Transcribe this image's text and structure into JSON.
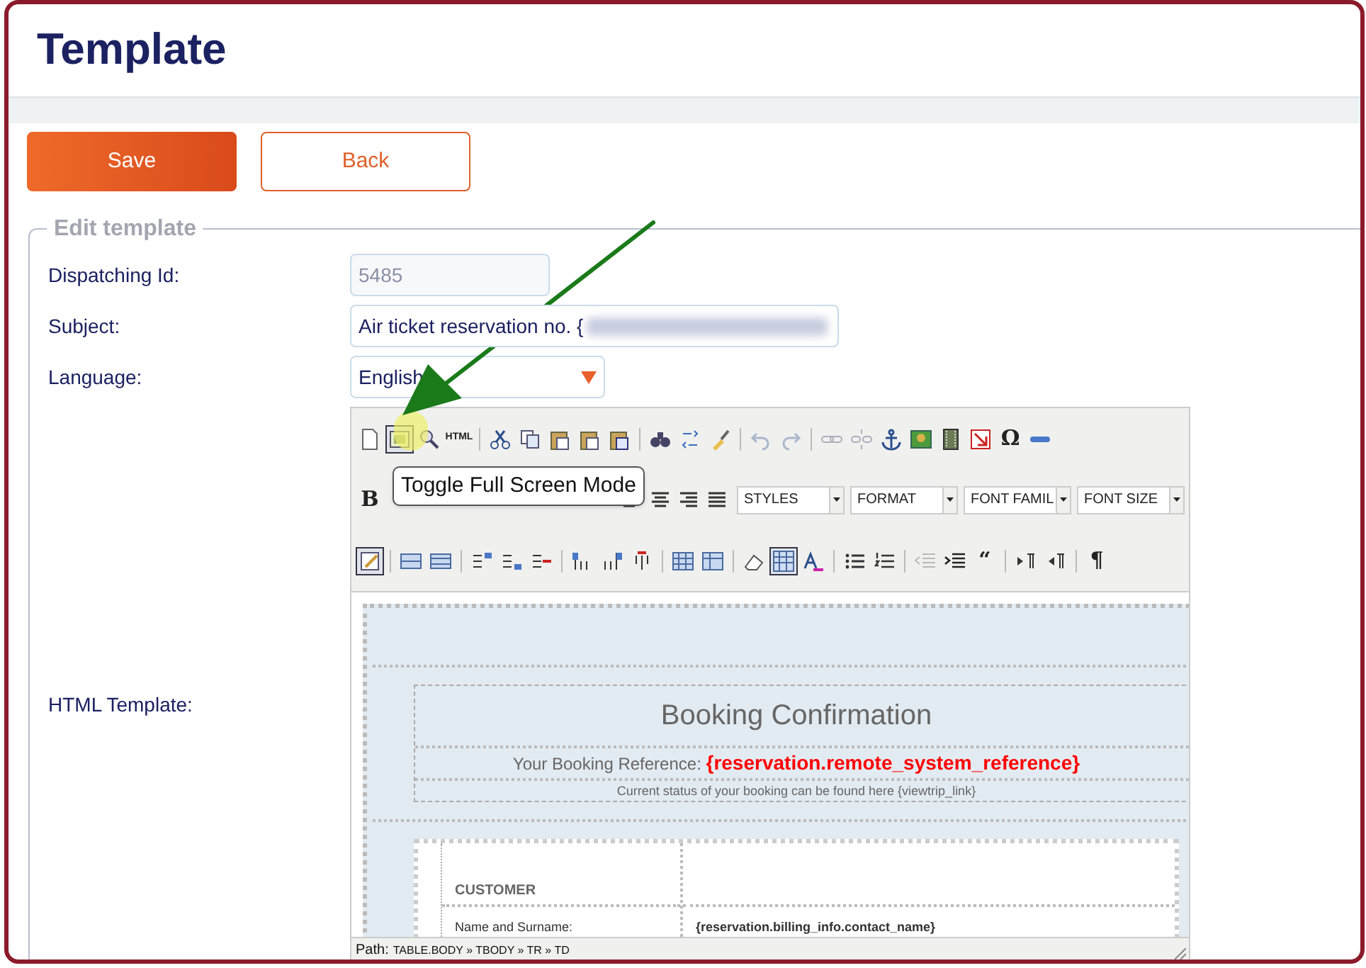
{
  "page": {
    "title": "Template"
  },
  "actions": [
    {
      "label": "Save",
      "kind": "primary"
    },
    {
      "label": "Back",
      "kind": "secondary"
    }
  ],
  "form": {
    "legend": "Edit template",
    "fields": [
      {
        "label": "Dispatching Id:",
        "kind": "input",
        "value": "5485",
        "disabled": true
      },
      {
        "label": "Subject:",
        "kind": "input",
        "value": "Air ticket reservation no. {",
        "disabled": false,
        "redacted": true
      },
      {
        "label": "Language:",
        "kind": "select",
        "value": "English",
        "disabled": false
      },
      {
        "label": "HTML Template:",
        "kind": "editor"
      }
    ]
  },
  "editor": {
    "toolbar_rows": [
      [
        {
          "kind": "icon"
        },
        {
          "kind": "icon",
          "selected": true
        },
        {
          "kind": "icon"
        },
        {
          "kind": "text",
          "label": "HTML"
        },
        {
          "kind": "sep"
        },
        {
          "kind": "icon"
        },
        {
          "kind": "icon"
        },
        {
          "kind": "icon"
        },
        {
          "kind": "icon"
        },
        {
          "kind": "icon"
        },
        {
          "kind": "sep"
        },
        {
          "kind": "icon"
        },
        {
          "kind": "icon"
        },
        {
          "kind": "icon"
        },
        {
          "kind": "sep"
        },
        {
          "kind": "icon",
          "disabled": true
        },
        {
          "kind": "icon",
          "disabled": true
        },
        {
          "kind": "sep"
        },
        {
          "kind": "icon",
          "disabled": true
        },
        {
          "kind": "icon",
          "disabled": true
        },
        {
          "kind": "icon"
        },
        {
          "kind": "icon"
        },
        {
          "kind": "icon"
        },
        {
          "kind": "icon"
        },
        {
          "kind": "text",
          "label": "Ω"
        },
        {
          "kind": "icon"
        }
      ],
      [
        {
          "kind": "text",
          "label": "B"
        },
        {
          "kind": "gap"
        },
        {
          "kind": "icon"
        },
        {
          "kind": "icon"
        },
        {
          "kind": "icon"
        },
        {
          "kind": "icon"
        },
        {
          "kind": "select",
          "label": "STYLES"
        },
        {
          "kind": "select",
          "label": "FORMAT"
        },
        {
          "kind": "select",
          "label": "FONT FAMIL"
        },
        {
          "kind": "select",
          "label": "FONT SIZE"
        }
      ],
      [
        {
          "kind": "icon",
          "selected": true
        },
        {
          "kind": "sep"
        },
        {
          "kind": "icon"
        },
        {
          "kind": "icon"
        },
        {
          "kind": "sep"
        },
        {
          "kind": "icon"
        },
        {
          "kind": "icon"
        },
        {
          "kind": "icon"
        },
        {
          "kind": "sep"
        },
        {
          "kind": "icon"
        },
        {
          "kind": "icon"
        },
        {
          "kind": "icon"
        },
        {
          "kind": "sep"
        },
        {
          "kind": "icon"
        },
        {
          "kind": "icon"
        },
        {
          "kind": "sep"
        },
        {
          "kind": "icon"
        },
        {
          "kind": "icon",
          "selected": true
        },
        {
          "kind": "icon"
        },
        {
          "kind": "sep"
        },
        {
          "kind": "icon"
        },
        {
          "kind": "icon"
        },
        {
          "kind": "sep"
        },
        {
          "kind": "icon",
          "disabled": true
        },
        {
          "kind": "icon"
        },
        {
          "kind": "text",
          "label": "“"
        },
        {
          "kind": "sep"
        },
        {
          "kind": "icon"
        },
        {
          "kind": "icon"
        },
        {
          "kind": "sep"
        },
        {
          "kind": "text",
          "label": "¶"
        }
      ]
    ],
    "tooltip": "Toggle Full Screen Mode",
    "content": {
      "heading": "Booking Confirmation",
      "reference_label": "Your Booking Reference:",
      "reference_value": "{reservation.remote_system_reference}",
      "status_note": "Current status of your booking can be found here {viewtrip_link}",
      "section": "CUSTOMER",
      "rows": [
        {
          "label": "Name and Surname:",
          "value": "{reservation.billing_info.contact_name}"
        }
      ]
    },
    "path": {
      "label": "Path:",
      "separator": "»",
      "items": [
        "TABLE.BODY",
        "TBODY",
        "TR",
        "TD"
      ]
    }
  }
}
